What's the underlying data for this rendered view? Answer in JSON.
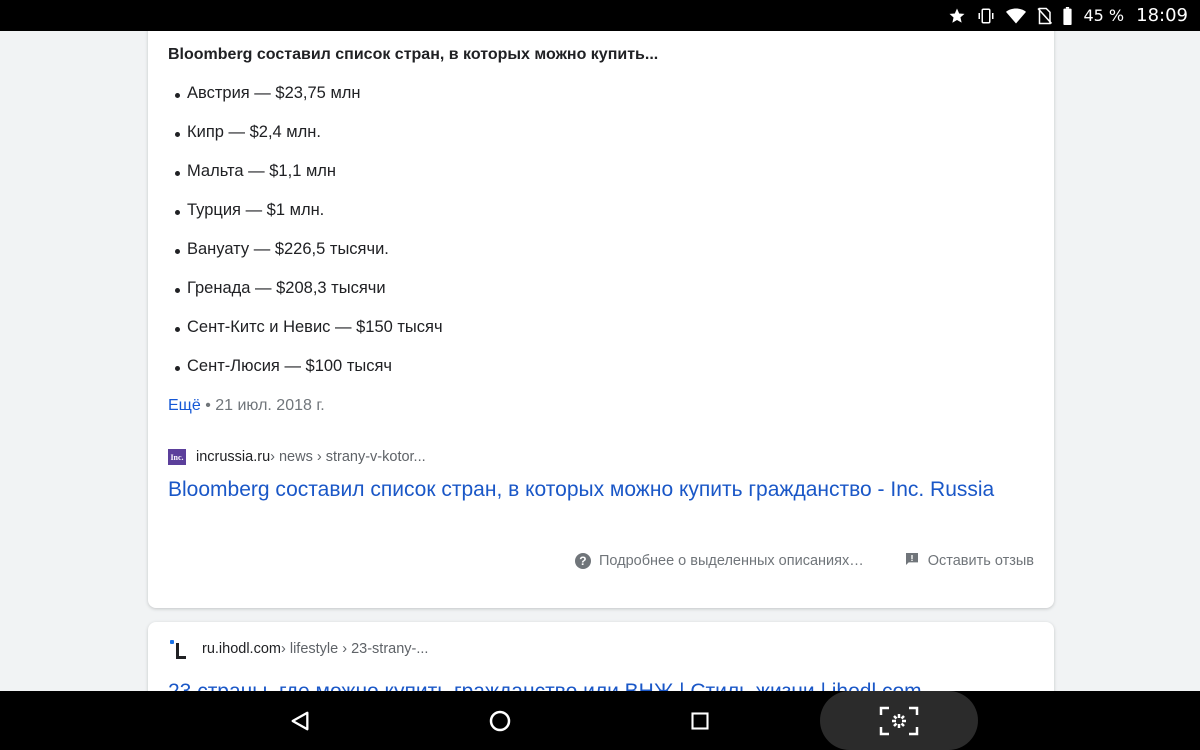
{
  "status_bar": {
    "battery": "45 %",
    "time": "18:09",
    "icons": [
      "star-icon",
      "vibrate-icon",
      "wifi-icon",
      "no-sim-icon",
      "battery-icon"
    ]
  },
  "featured_snippet": {
    "title": "Bloomberg составил список стран, в которых можно купить...",
    "items": [
      "Австрия — $23,75 млн",
      "Кипр — $2,4 млн.",
      "Мальта — $1,1 млн",
      "Турция — $1 млн.",
      "Вануату — $226,5 тысячи.",
      "Гренада — $208,3 тысячи",
      "Сент-Китс и Невис — $150 тысяч",
      "Сент-Люсия — $100 тысяч"
    ],
    "more_label": "Ещё",
    "date": "21 июл. 2018 г.",
    "source_domain": "incrussia.ru",
    "source_path": " › news › strany-v-kotor...",
    "favicon_text": "Inc.",
    "result_title": "Bloomberg составил список стран, в которых можно купить гражданство - Inc. Russia",
    "about_label": "Подробнее о выделенных описаниях…",
    "feedback_label": "Оставить отзыв"
  },
  "next_result": {
    "source_domain": "ru.ihodl.com",
    "source_path": " › lifestyle › 23-strany-...",
    "title_partial": "23 страны, где можно купить гражданство или ВНЖ | Стиль жизни | ihodl.com"
  },
  "colors": {
    "link": "#1a57c7",
    "text": "#202124",
    "muted": "#70757a",
    "background": "#f1f3f4"
  }
}
